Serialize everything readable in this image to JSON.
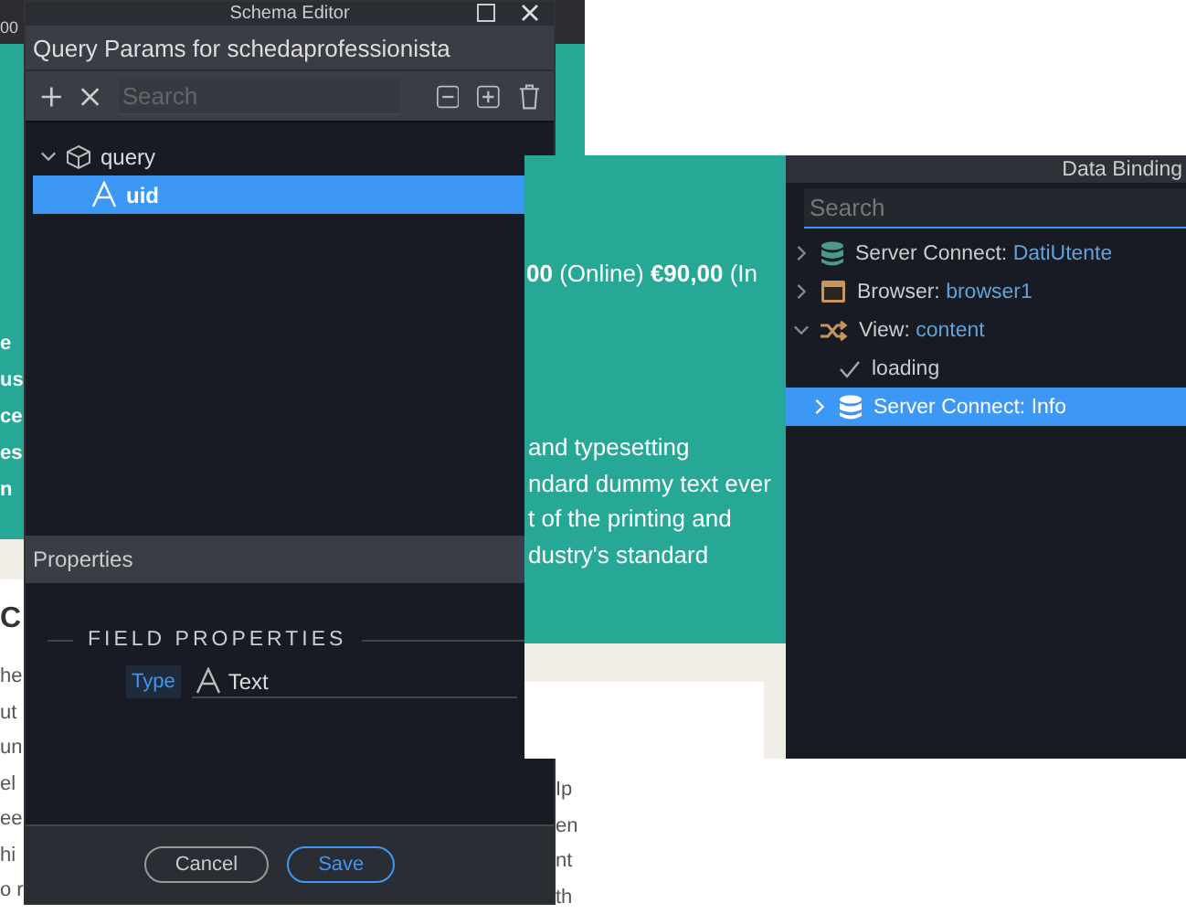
{
  "ruler": {
    "label": "00"
  },
  "background_page": {
    "left_lines": [
      "e",
      "us",
      "ce",
      "es",
      "n"
    ],
    "heading": "C",
    "left_body": [
      "he",
      "ut",
      "un",
      "el",
      "ee",
      "hi",
      "o r"
    ],
    "right_body": [
      "Ip",
      "en",
      "nt",
      "th"
    ]
  },
  "schema_editor": {
    "title": "Schema Editor",
    "subtitle": "Query Params for schedaprofessionista",
    "search": {
      "placeholder": "Search"
    },
    "tree": [
      {
        "label": "query",
        "kind": "object",
        "expanded": true,
        "selected": false,
        "children": [
          {
            "label": "uid",
            "kind": "text",
            "selected": true
          }
        ]
      }
    ],
    "properties_title": "Properties",
    "section_title": "FIELD PROPERTIES",
    "fields": [
      {
        "label": "Type",
        "value": "Text",
        "kind": "text"
      }
    ],
    "buttons": [
      {
        "label": "Cancel",
        "primary": false
      },
      {
        "label": "Save",
        "primary": true
      }
    ]
  },
  "preview": {
    "price_line": "**00** (Online) **€90,00** (In",
    "paragraph_lines": [
      "and typesetting",
      "ndard dummy text ever",
      "t of the printing and",
      "dustry's standard"
    ]
  },
  "data_binding": {
    "title": "Data Binding",
    "search": {
      "placeholder": "Search"
    },
    "tree": [
      {
        "label": "Server Connect:",
        "value": "DatiUtente",
        "kind": "server-connect",
        "expanded": false,
        "selected": false
      },
      {
        "label": "Browser:",
        "value": "browser1",
        "kind": "browser",
        "expanded": false,
        "selected": false
      },
      {
        "label": "View:",
        "value": "content",
        "kind": "view",
        "expanded": true,
        "selected": false,
        "children": [
          {
            "label": "loading",
            "kind": "property",
            "selected": false
          },
          {
            "label": "Server Connect:",
            "value": "Info",
            "kind": "server-connect",
            "expanded": false,
            "selected": true
          }
        ]
      }
    ]
  }
}
